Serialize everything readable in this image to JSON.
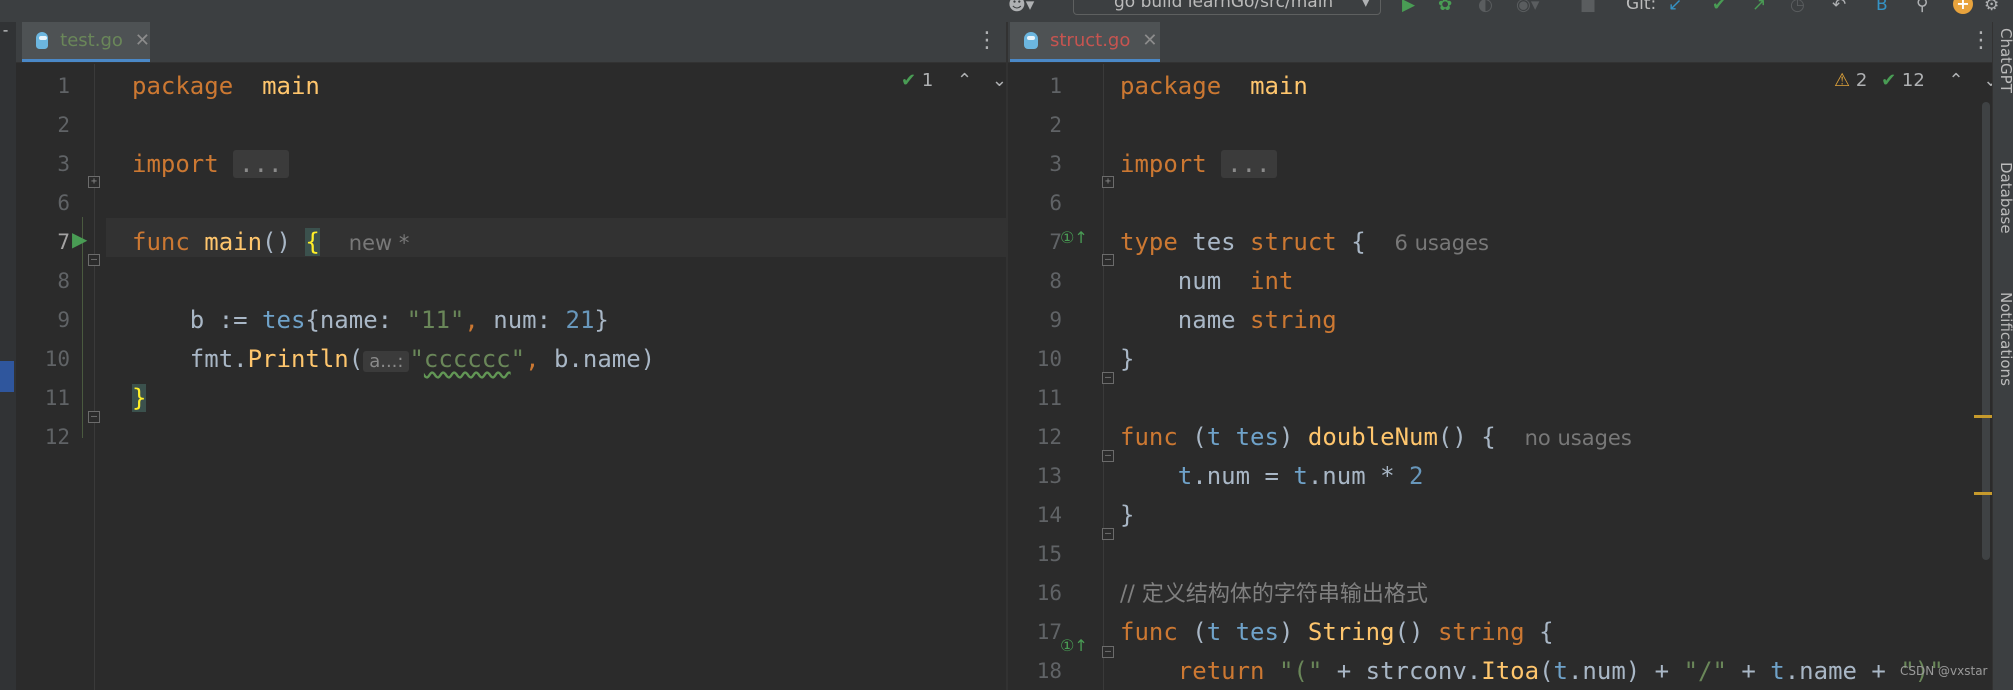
{
  "toolbar": {
    "run_config": "go build learnGo/src/main",
    "git_label": "Git:"
  },
  "left_editor": {
    "tab_label": "test.go",
    "inspection": {
      "ok_count": "1"
    },
    "line_numbers": [
      "1",
      "2",
      "3",
      "6",
      "7",
      "8",
      "9",
      "10",
      "11",
      "12"
    ],
    "lines": [
      {
        "t": [
          [
            "kw",
            "package"
          ],
          [
            "",
            "  "
          ],
          [
            "fn",
            "main"
          ]
        ]
      },
      {
        "t": []
      },
      {
        "t": [
          [
            "kw",
            "import"
          ],
          [
            "",
            " "
          ],
          [
            "chip",
            "..."
          ]
        ]
      },
      {
        "t": []
      },
      {
        "t": [
          [
            "kw",
            "func"
          ],
          [
            "",
            " "
          ],
          [
            "fn",
            "main"
          ],
          [
            "",
            "() "
          ],
          [
            "bh",
            "{"
          ],
          [
            "",
            "  "
          ],
          [
            "hint",
            "new *"
          ]
        ]
      },
      {
        "t": []
      },
      {
        "t": [
          [
            "",
            "    b := "
          ],
          [
            "typ",
            "tes"
          ],
          [
            "",
            "{name: "
          ],
          [
            "str",
            "\"11\""
          ],
          [
            "kw",
            ", "
          ],
          [
            "",
            "num: "
          ],
          [
            "num",
            "21"
          ],
          [
            "",
            "}"
          ]
        ]
      },
      {
        "t": [
          [
            "",
            "    fmt."
          ],
          [
            "fn",
            "Println"
          ],
          [
            "",
            "("
          ],
          [
            "ph",
            "a...:"
          ],
          [
            "str",
            "\""
          ],
          [
            "wv",
            "cccccc"
          ],
          [
            "str",
            "\""
          ],
          [
            "kw",
            ", "
          ],
          [
            "",
            "b.name)"
          ]
        ]
      },
      {
        "t": [
          [
            "bh",
            "}"
          ]
        ]
      },
      {
        "t": []
      }
    ]
  },
  "right_editor": {
    "tab_label": "struct.go",
    "inspection": {
      "warn_count": "2",
      "ok_count": "12"
    },
    "line_numbers": [
      "1",
      "2",
      "3",
      "6",
      "7",
      "8",
      "9",
      "10",
      "11",
      "12",
      "13",
      "14",
      "15",
      "16",
      "17",
      "18"
    ],
    "lines": [
      {
        "t": [
          [
            "kw",
            "package"
          ],
          [
            "",
            "  "
          ],
          [
            "fn",
            "main"
          ]
        ]
      },
      {
        "t": []
      },
      {
        "t": [
          [
            "kw",
            "import"
          ],
          [
            "",
            " "
          ],
          [
            "chip",
            "..."
          ]
        ]
      },
      {
        "t": []
      },
      {
        "t": [
          [
            "kw",
            "type"
          ],
          [
            "",
            " tes "
          ],
          [
            "kw",
            "struct"
          ],
          [
            "",
            " {  "
          ],
          [
            "hint",
            "6 usages"
          ]
        ]
      },
      {
        "t": [
          [
            "",
            "    num  "
          ],
          [
            "kw",
            "int"
          ]
        ]
      },
      {
        "t": [
          [
            "",
            "    name "
          ],
          [
            "kw",
            "string"
          ]
        ]
      },
      {
        "t": [
          [
            "",
            "}"
          ]
        ]
      },
      {
        "t": []
      },
      {
        "t": [
          [
            "kw",
            "func"
          ],
          [
            "",
            " ("
          ],
          [
            "typ",
            "t"
          ],
          [
            "",
            " "
          ],
          [
            "typ",
            "tes"
          ],
          [
            "",
            ") "
          ],
          [
            "fn",
            "doubleNum"
          ],
          [
            "",
            "() {  "
          ],
          [
            "hint",
            "no usages"
          ]
        ]
      },
      {
        "t": [
          [
            "",
            "    "
          ],
          [
            "typ",
            "t"
          ],
          [
            "",
            ".num = "
          ],
          [
            "typ",
            "t"
          ],
          [
            "",
            ".num * "
          ],
          [
            "num",
            "2"
          ]
        ]
      },
      {
        "t": [
          [
            "",
            "}"
          ]
        ]
      },
      {
        "t": []
      },
      {
        "t": [
          [
            "cmt",
            "// 定义结构体的字符串输出格式"
          ]
        ]
      },
      {
        "t": [
          [
            "kw",
            "func"
          ],
          [
            "",
            " ("
          ],
          [
            "typ",
            "t"
          ],
          [
            "",
            " "
          ],
          [
            "typ",
            "tes"
          ],
          [
            "",
            ") "
          ],
          [
            "fn",
            "String"
          ],
          [
            "",
            "() "
          ],
          [
            "kw",
            "string"
          ],
          [
            "",
            " {"
          ]
        ]
      },
      {
        "t": [
          [
            "",
            "    "
          ],
          [
            "kw",
            "return"
          ],
          [
            "",
            " "
          ],
          [
            "str",
            "\"(\""
          ],
          [
            "",
            " + strconv."
          ],
          [
            "fn",
            "Itoa"
          ],
          [
            "",
            "("
          ],
          [
            "typ",
            "t"
          ],
          [
            "",
            ".num) + "
          ],
          [
            "str",
            "\"/\""
          ],
          [
            "",
            " + "
          ],
          [
            "typ",
            "t"
          ],
          [
            "",
            ".name + "
          ],
          [
            "str",
            "\")\""
          ]
        ]
      }
    ]
  },
  "right_sidebar": {
    "items": [
      "ChatGPT",
      "Database",
      "Notifications"
    ]
  },
  "watermark": "CSDN @vxstar",
  "colors": {
    "background": "#2b2b2b",
    "keyword": "#cc7832",
    "function": "#ffc66d",
    "string": "#6a8759",
    "number": "#6897bb",
    "tab_active_left": "#6a8759",
    "tab_active_right": "#c75450"
  }
}
